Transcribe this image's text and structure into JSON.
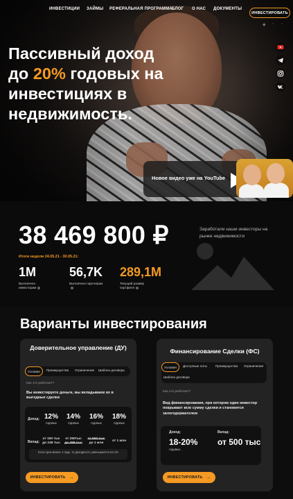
{
  "nav": {
    "items": [
      "ИНВЕСТИЦИИ",
      "ЗАЙМЫ",
      "РЕФЕРАЛЬНАЯ ПРОГРАММА",
      "БЛОГ",
      "О НАС",
      "ДОКУМЕНТЫ"
    ],
    "cta": "ИНВЕСТИРОВАТЬ"
  },
  "hero": {
    "headline_part1": "Пассивный доход до ",
    "headline_accent": "20%",
    "headline_part2": " годовых на инвестициях в недвижимость.",
    "social_icons": [
      "youtube-icon",
      "telegram-icon",
      "instagram-icon",
      "vk-icon"
    ],
    "youtube_banner": "Новое видео уже на YouTube"
  },
  "stats": {
    "total": "38 469 800 ₽",
    "total_label": "Заработали наши инвесторы на рынке недвижимости",
    "week": "Итоги недели 24.05.21 - 30.05.21:",
    "items": [
      {
        "value": "1M",
        "label": "Выплачено инвесторам"
      },
      {
        "value": "56,7K",
        "label": "Выплачено партнерам"
      },
      {
        "value": "289,1M",
        "label": "Текущий размер портфеля"
      }
    ]
  },
  "variants": {
    "title": "Варианты инвестирования",
    "cards": [
      {
        "title": "Доверительное управление (ДУ)",
        "tabs": [
          "Условия",
          "Преимущества",
          "Ограничения",
          "Шаблон договора"
        ],
        "how": "Как это работает?",
        "description": "Вы инвестируете деньги, мы вкладываем их в выгодные сделки",
        "income_label": "Доход:",
        "rates": [
          "12%",
          "14%",
          "16%",
          "18%"
        ],
        "rate_sub": "годовых",
        "deposit_label": "Вклад:",
        "deposits": [
          {
            "a": "от 150 тыс",
            "b": "до 249 тыс"
          },
          {
            "a": "от 250тыс",
            "b": "до 499 тыс"
          },
          {
            "a": "от 500 тыс",
            "b": "до 1 млн"
          },
          {
            "a": "от 1 млн",
            "b": ""
          }
        ],
        "note": "Если срок менее 1 года, то доходность уменьшается на 1%",
        "button": "ИНВЕСТИРОВАТЬ"
      },
      {
        "title": "Финансирование Сделки (ФС)",
        "tabs": [
          "Условия",
          "Доступные лоты",
          "Преимущества",
          "Ограничения",
          "Шаблон договора"
        ],
        "how": "Как это работает?",
        "description": "Вид финансирования, при котором один инвестор покрывает всю сумму сделки и становится залогодержателем",
        "income_label": "Доход:",
        "income_value": "18-20%",
        "income_sub": "годовых",
        "deposit_label": "Вклад:",
        "deposit_value": "от 500 тыс",
        "button": "ИНВЕСТИРОВАТЬ"
      }
    ]
  },
  "colors": {
    "accent": "#f59a23",
    "background": "#0d0d0d",
    "card": "#232323"
  }
}
